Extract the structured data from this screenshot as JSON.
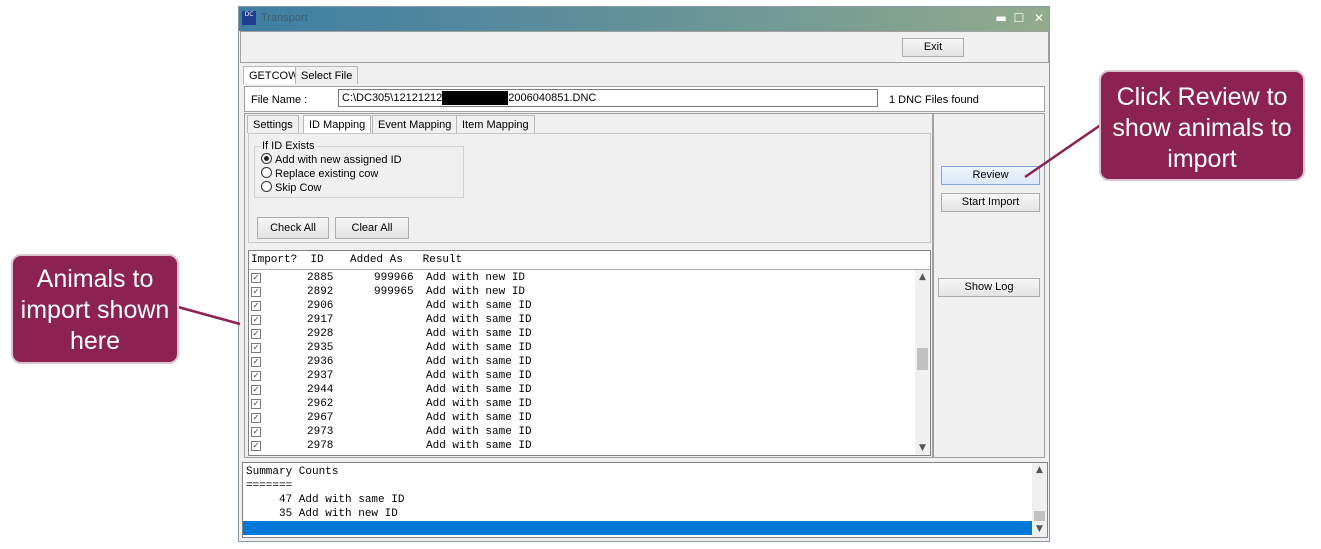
{
  "window": {
    "title": "Transport",
    "icon_label": "DC",
    "minimize": "▬",
    "maximize": "☐",
    "close": "✕"
  },
  "toolbar": {
    "exit": "Exit"
  },
  "outer_tabs": [
    "GETCOW",
    "Select File"
  ],
  "file": {
    "label": "File Name :",
    "value_prefix": "C:\\DC305\\12121212",
    "value_suffix": "2006040851.DNC",
    "status": "1 DNC Files found"
  },
  "inner_tabs": [
    "Settings",
    "ID Mapping",
    "Event Mapping",
    "Item Mapping"
  ],
  "id_exists": {
    "legend": "If ID Exists",
    "options": [
      "Add with new assigned ID",
      "Replace existing cow",
      "Skip Cow"
    ],
    "selected": 0
  },
  "buttons": {
    "check_all": "Check All",
    "clear_all": "Clear All",
    "review": "Review",
    "start_import": "Start Import",
    "show_log": "Show Log"
  },
  "grid": {
    "header": "Import?  ID    Added As   Result",
    "rows": [
      {
        "checked": true,
        "id": "2885",
        "added_as": "999966",
        "result": "Add with new ID"
      },
      {
        "checked": true,
        "id": "2892",
        "added_as": "999965",
        "result": "Add with new ID"
      },
      {
        "checked": true,
        "id": "2906",
        "added_as": "",
        "result": "Add with same ID"
      },
      {
        "checked": true,
        "id": "2917",
        "added_as": "",
        "result": "Add with same ID"
      },
      {
        "checked": true,
        "id": "2928",
        "added_as": "",
        "result": "Add with same ID"
      },
      {
        "checked": true,
        "id": "2935",
        "added_as": "",
        "result": "Add with same ID"
      },
      {
        "checked": true,
        "id": "2936",
        "added_as": "",
        "result": "Add with same ID"
      },
      {
        "checked": true,
        "id": "2937",
        "added_as": "",
        "result": "Add with same ID"
      },
      {
        "checked": true,
        "id": "2944",
        "added_as": "",
        "result": "Add with same ID"
      },
      {
        "checked": true,
        "id": "2962",
        "added_as": "",
        "result": "Add with same ID"
      },
      {
        "checked": true,
        "id": "2967",
        "added_as": "",
        "result": "Add with same ID"
      },
      {
        "checked": true,
        "id": "2973",
        "added_as": "",
        "result": "Add with same ID"
      },
      {
        "checked": true,
        "id": "2978",
        "added_as": "",
        "result": "Add with same ID"
      }
    ]
  },
  "summary": {
    "lines": [
      "Summary Counts",
      "=======",
      "     47 Add with same ID",
      "     35 Add with new ID"
    ]
  },
  "callouts": {
    "review": "Click Review to show animals to import",
    "list": "Animals to import shown here"
  },
  "colors": {
    "callout": "#8b2252",
    "selection": "#0078d7"
  }
}
